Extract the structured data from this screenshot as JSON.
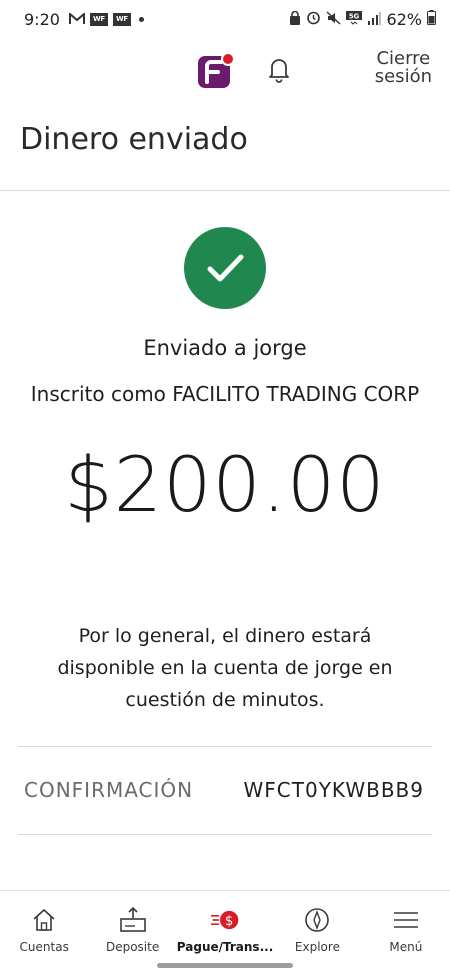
{
  "status_bar": {
    "time": "9:20",
    "badges": [
      "WF",
      "WF"
    ],
    "network": "5G",
    "battery_percent": "62%"
  },
  "header": {
    "signout_line1": "Cierre",
    "signout_line2": "sesión",
    "logo_icon": "brand-f-logo",
    "notification_icon": "bell-icon",
    "brand_colors": {
      "purple": "#6a1b6e",
      "red": "#d71e28"
    }
  },
  "page": {
    "title": "Dinero enviado",
    "sent_to": "Enviado a jorge",
    "enrolled_as": "Inscrito como FACILITO TRADING CORP",
    "amount": "$200.00",
    "availability_note": "Por lo general, el dinero estará disponible en la cuenta de jorge en cuestión de minutos.",
    "success_color": "#20874f"
  },
  "confirmation": {
    "label": "CONFIRMACIÓN",
    "value": "WFCT0YKWBBB9"
  },
  "bottom_nav": {
    "items": [
      {
        "label": "Cuentas",
        "icon": "home-icon"
      },
      {
        "label": "Deposite",
        "icon": "deposit-icon"
      },
      {
        "label": "Pague/Trans...",
        "icon": "pay-transfer-icon",
        "active": true
      },
      {
        "label": "Explore",
        "icon": "compass-icon"
      },
      {
        "label": "Menú",
        "icon": "hamburger-menu-icon"
      }
    ]
  }
}
